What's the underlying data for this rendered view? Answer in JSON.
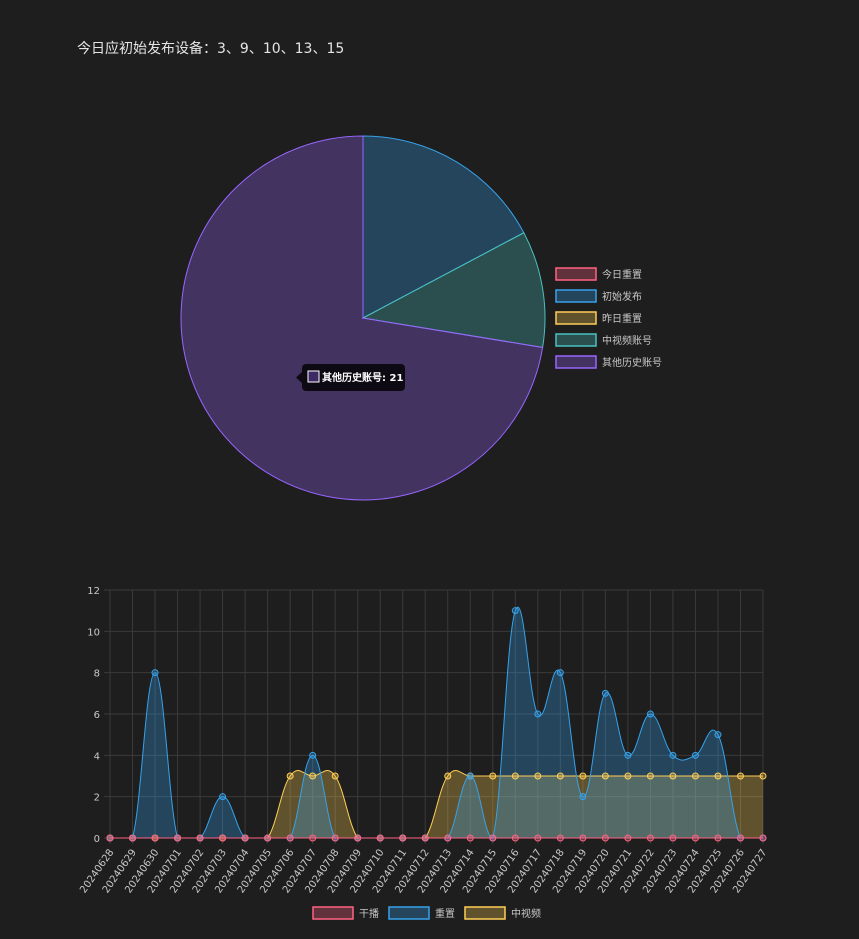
{
  "header": {
    "title": "今日应初始发布设备：3、9、10、13、15"
  },
  "chart_data": [
    {
      "type": "pie",
      "slices": [
        {
          "name": "今日重置",
          "value": 0,
          "color": "#ff6384"
        },
        {
          "name": "初始发布",
          "value": 5,
          "color": "#36a2eb"
        },
        {
          "name": "昨日重置",
          "value": 0,
          "color": "#ffce56"
        },
        {
          "name": "中视频账号",
          "value": 3,
          "color": "#4bc0c0"
        },
        {
          "name": "其他历史账号",
          "value": 21,
          "color": "#9966ff"
        }
      ],
      "tooltip": {
        "label": "其他历史账号: 21"
      },
      "legend_position": "right"
    },
    {
      "type": "area",
      "categories": [
        "20240628",
        "20240629",
        "20240630",
        "20240701",
        "20240702",
        "20240703",
        "20240704",
        "20240705",
        "20240706",
        "20240707",
        "20240708",
        "20240709",
        "20240710",
        "20240711",
        "20240712",
        "20240713",
        "20240714",
        "20240715",
        "20240716",
        "20240717",
        "20240718",
        "20240719",
        "20240720",
        "20240721",
        "20240722",
        "20240723",
        "20240724",
        "20240725",
        "20240726",
        "20240727"
      ],
      "series": [
        {
          "name": "干播",
          "color": "#ff6384",
          "values": [
            0,
            0,
            0,
            0,
            0,
            0,
            0,
            0,
            0,
            0,
            0,
            0,
            0,
            0,
            0,
            0,
            0,
            0,
            0,
            0,
            0,
            0,
            0,
            0,
            0,
            0,
            0,
            0,
            0,
            0
          ]
        },
        {
          "name": "重置",
          "color": "#36a2eb",
          "values": [
            0,
            0,
            8,
            0,
            0,
            2,
            0,
            0,
            0,
            4,
            0,
            0,
            0,
            0,
            0,
            0,
            3,
            0,
            11,
            6,
            8,
            2,
            7,
            4,
            6,
            4,
            4,
            5,
            0,
            0
          ]
        },
        {
          "name": "中视频",
          "color": "#ffce56",
          "values": [
            0,
            0,
            0,
            0,
            0,
            0,
            0,
            0,
            3,
            3,
            3,
            0,
            0,
            0,
            0,
            3,
            3,
            3,
            3,
            3,
            3,
            3,
            3,
            3,
            3,
            3,
            3,
            3,
            3,
            3
          ]
        }
      ],
      "ylim": [
        0,
        12
      ],
      "yticks": [
        "0",
        "2",
        "4",
        "6",
        "8",
        "10",
        "12"
      ],
      "grid": true,
      "legend_position": "bottom"
    }
  ]
}
